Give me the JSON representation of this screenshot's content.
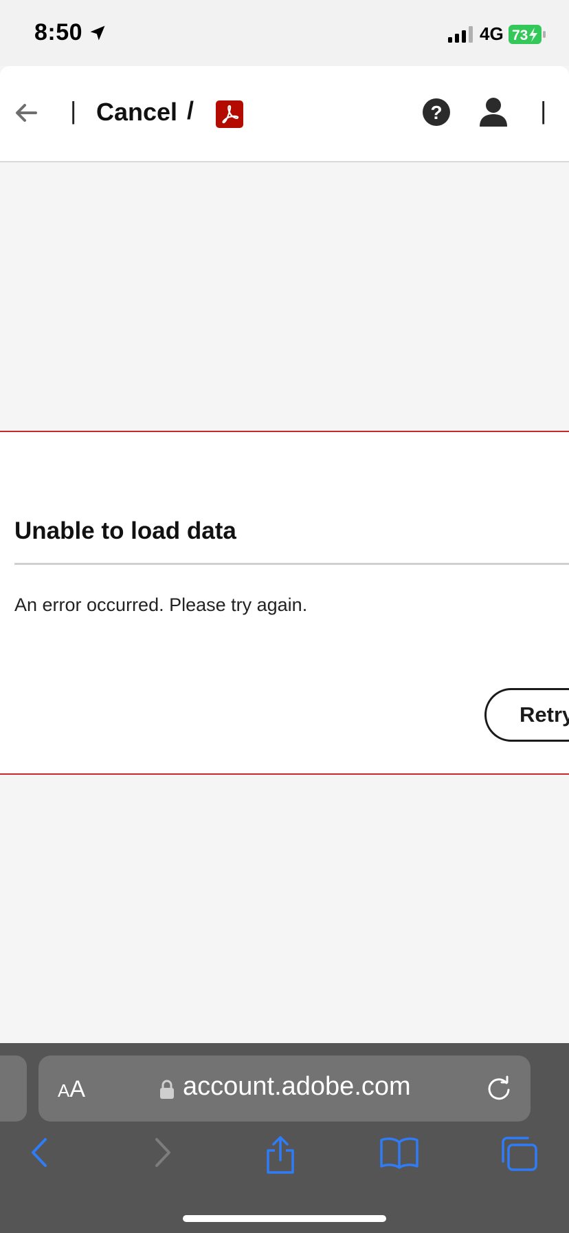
{
  "status_bar": {
    "time": "8:50",
    "network": "4G",
    "battery": "73"
  },
  "header": {
    "separator": "|",
    "cancel_label": "Cancel",
    "slash": "/"
  },
  "error": {
    "title": "Unable to load data",
    "message": "An error occurred. Please try again.",
    "retry_label": "Retry"
  },
  "browser": {
    "aa_small": "A",
    "aa_large": "A",
    "url": "account.adobe.com"
  },
  "colors": {
    "accent_red": "#c9252c",
    "acrobat_red": "#b30b00",
    "safari_blue": "#2f7cf6"
  },
  "icons": {
    "back": "arrow-left-icon",
    "help": "question-circle-icon",
    "user": "user-icon",
    "lock": "lock-icon",
    "reload": "reload-icon"
  }
}
